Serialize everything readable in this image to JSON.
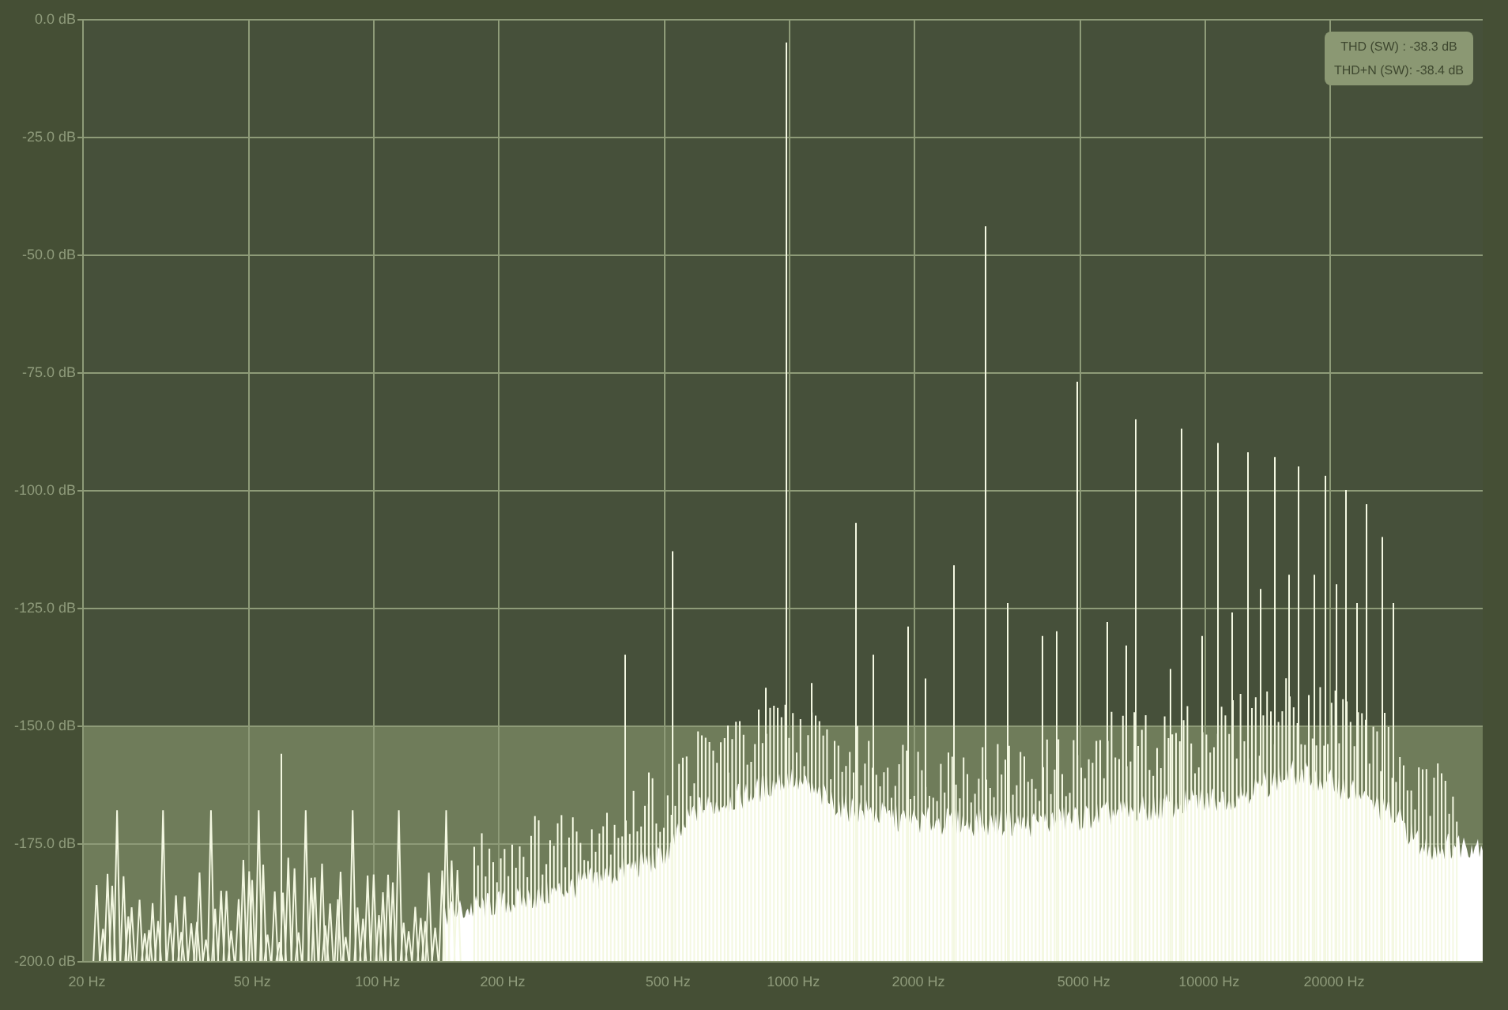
{
  "y_axis": {
    "ticks": [
      "0.0 dB",
      "-25.0 dB",
      "-50.0 dB",
      "-75.0 dB",
      "-100.0 dB",
      "-125.0 dB",
      "-150.0 dB",
      "-175.0 dB",
      "-200.0 dB"
    ]
  },
  "x_axis": {
    "ticks": [
      "20 Hz",
      "50 Hz",
      "100 Hz",
      "200 Hz",
      "500 Hz",
      "1000 Hz",
      "2000 Hz",
      "5000 Hz",
      "10000 Hz",
      "20000 Hz"
    ]
  },
  "readouts": [
    {
      "text": "THD (SW) : -38.3 dB"
    },
    {
      "text": "THD+N (SW): -38.4 dB"
    }
  ]
}
